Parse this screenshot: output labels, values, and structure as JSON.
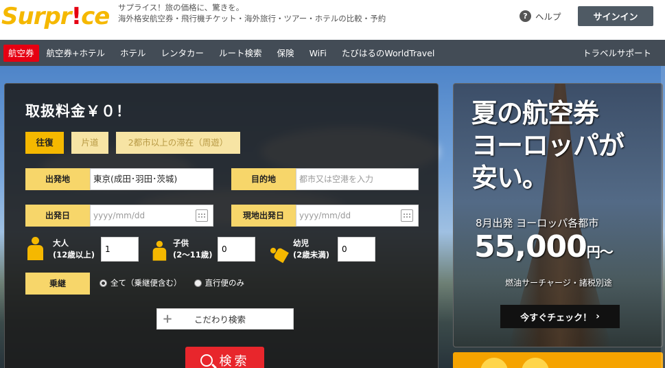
{
  "header": {
    "logo_pre": "Surpr",
    "logo_bang": "!",
    "logo_post": "ce",
    "tagline_line1": "サプライス！旅の価格に、驚きを。",
    "tagline_line2": "海外格安航空券・飛行機チケット・海外旅行・ツアー・ホテルの比較・予約",
    "help_label": "ヘルプ",
    "signin_label": "サインイン"
  },
  "nav": {
    "items": [
      {
        "label": "航空券"
      },
      {
        "label": "航空券+ホテル"
      },
      {
        "label": "ホテル"
      },
      {
        "label": "レンタカー"
      },
      {
        "label": "ルート検索"
      },
      {
        "label": "保険"
      },
      {
        "label": "WiFi"
      },
      {
        "label": "たびはるのWorldTravel"
      }
    ],
    "right_label": "トラベルサポート"
  },
  "search": {
    "title": "取扱料金￥０！",
    "tabs": [
      {
        "label": "往復"
      },
      {
        "label": "片道"
      },
      {
        "label": "2都市以上の滞在（周遊）"
      }
    ],
    "origin_label": "出発地",
    "origin_value": "東京(成田･羽田･茨城)",
    "dest_label": "目的地",
    "dest_placeholder": "都市又は空港を入力",
    "depart_label": "出発日",
    "depart_placeholder": "yyyy/mm/dd",
    "return_label": "現地出発日",
    "return_placeholder": "yyyy/mm/dd",
    "adult_label1": "大人",
    "adult_label2": "(12歳以上)",
    "adult_value": "1",
    "child_label1": "子供",
    "child_label2": "(2〜11歳)",
    "child_value": "0",
    "infant_label1": "幼児",
    "infant_label2": "(2歳未満)",
    "infant_value": "0",
    "transit_label": "乗継",
    "transit_option1": "全て（乗継便含む）",
    "transit_option2": "直行便のみ",
    "advanced_label": "こだわり検索",
    "search_label": "検索"
  },
  "promo": {
    "heading_line1": "夏の航空券",
    "heading_line2": "ヨーロッパが",
    "heading_line3": "安い。",
    "sub": "8月出発 ヨーロッパ各都市",
    "price": "55,000",
    "price_unit": "円〜",
    "note": "燃油サーチャージ・諸税別途",
    "cta": "今すぐチェック！"
  }
}
